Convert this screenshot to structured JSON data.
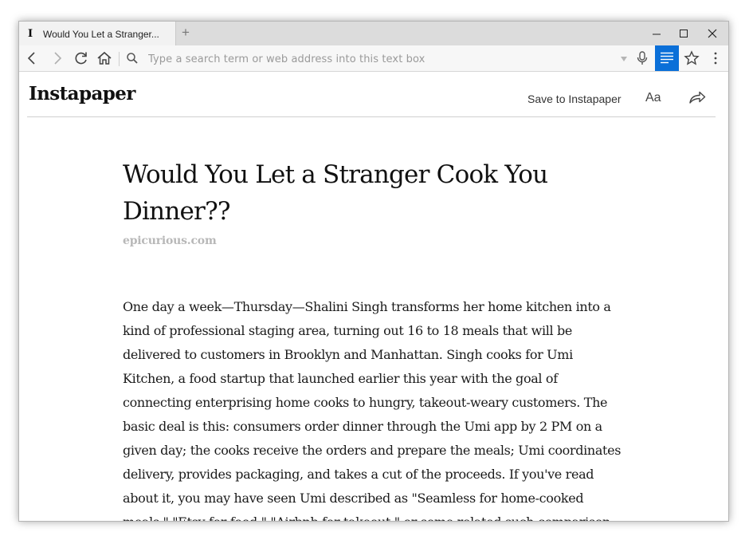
{
  "browser": {
    "tab": {
      "favicon": "I",
      "title": "Would You Let a Stranger..."
    },
    "new_tab_label": "+",
    "window_buttons": {
      "minimize": "—",
      "maximize": "☐",
      "close": "✕"
    },
    "address_bar": {
      "placeholder": "Type a search term or web address into this text box",
      "value": ""
    },
    "icons": [
      "back-icon",
      "forward-icon",
      "reload-icon",
      "home-icon",
      "search-icon",
      "dropdown-icon",
      "microphone-icon",
      "reader-view-icon",
      "star-icon",
      "menu-icon"
    ],
    "accent_color": "#0a6fd8"
  },
  "app": {
    "logo": "Instapaper",
    "save_label": "Save to Instapaper",
    "font_button": "Aa",
    "share_icon": "share-icon"
  },
  "article": {
    "title": "Would You Let a Stranger Cook You Dinner??",
    "source": "epicurious.com",
    "body": "One day a week—Thursday—Shalini Singh transforms her home kitchen into a kind of professional staging area, turning out 16 to 18 meals that will be delivered to customers in Brooklyn and Manhattan. Singh cooks for Umi Kitchen, a food startup that launched earlier this year with the goal of connecting enterprising home cooks to hungry, takeout-weary customers. The basic deal is this: consumers order dinner through the Umi app by 2 PM on a given day; the cooks receive the orders and prepare the meals; Umi coordinates delivery, provides packaging, and takes a cut of the proceeds. If you've read about it, you may have seen Umi described as \"Seamless for home-cooked meals,\" \"Etsy for food,\" \"Airbnb for takeout,\" or some related such comparison for the gig"
  }
}
